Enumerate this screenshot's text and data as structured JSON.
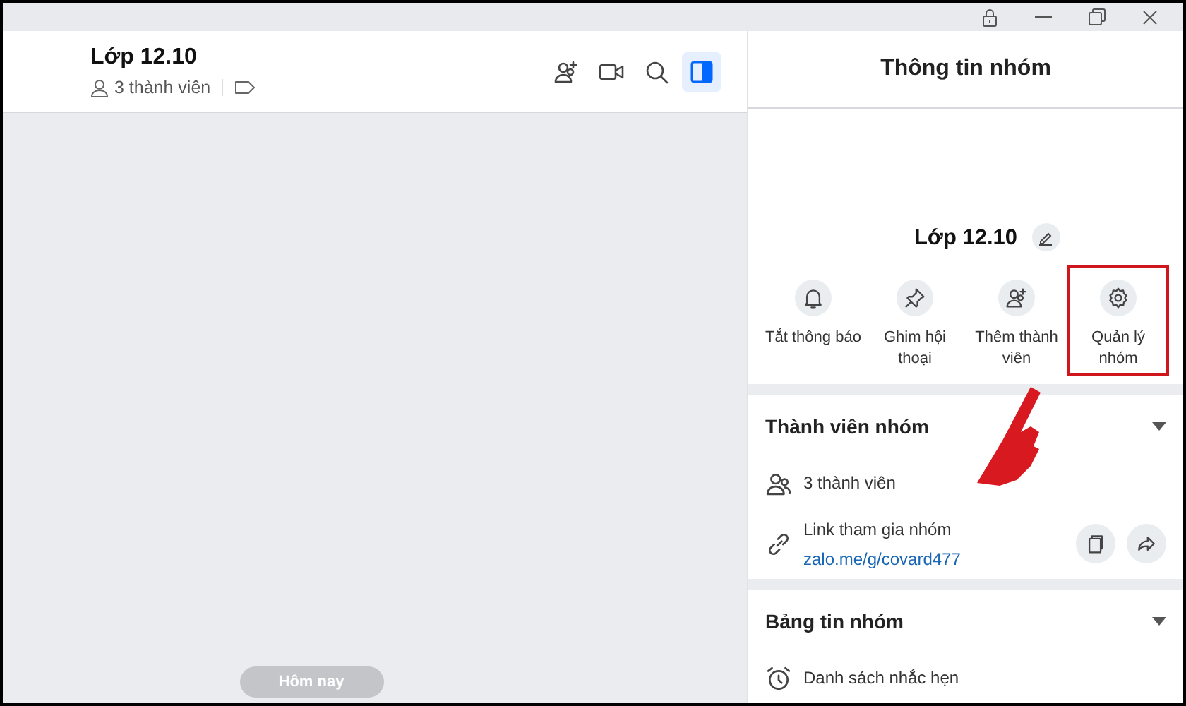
{
  "chat": {
    "title": "Lớp 12.10",
    "members": "3 thành viên",
    "date_chip": "Hôm nay",
    "toolbar": [
      {
        "kind": "add-member",
        "selected": false
      },
      {
        "kind": "video",
        "selected": false
      },
      {
        "kind": "search",
        "selected": false
      },
      {
        "kind": "panel",
        "selected": true
      }
    ]
  },
  "info_panel": {
    "title": "Thông tin nhóm",
    "group_name": "Lớp 12.10",
    "actions": [
      {
        "kind": "bell",
        "label": "Tắt thông báo",
        "highlighted": false
      },
      {
        "kind": "pin",
        "label": "Ghim hội thoại",
        "highlighted": false
      },
      {
        "kind": "add-member",
        "label": "Thêm thành viên",
        "highlighted": false
      },
      {
        "kind": "gear",
        "label": "Quản lý nhóm",
        "highlighted": true
      }
    ],
    "sections": [
      {
        "title": "Thành viên nhóm",
        "items": [
          {
            "kind": "members",
            "text": "3 thành viên"
          },
          {
            "kind": "link",
            "text": "Link tham gia nhóm",
            "link": "zalo.me/g/covard477"
          }
        ]
      },
      {
        "title": "Bảng tin nhóm",
        "items": [
          {
            "kind": "reminder",
            "text": "Danh sách nhắc hẹn"
          }
        ]
      }
    ]
  }
}
